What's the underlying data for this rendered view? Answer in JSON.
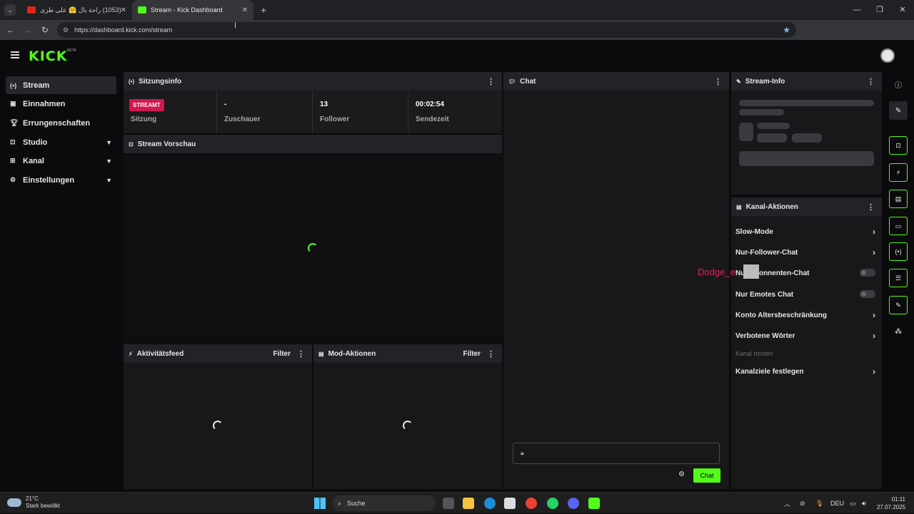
{
  "browser": {
    "tabs": [
      {
        "title": "(1053) راحة بال 🤗 علی طزی",
        "icon": "youtube-icon"
      },
      {
        "title": "Stream - Kick Dashboard",
        "icon": "kick-icon"
      }
    ],
    "url": "https://dashboard.kick.com/stream"
  },
  "app": {
    "logo": "KICK",
    "beta": "BETA"
  },
  "sidebar": {
    "items": [
      {
        "label": "Stream",
        "icon": "broadcast-icon",
        "active": true
      },
      {
        "label": "Einnahmen",
        "icon": "money-icon"
      },
      {
        "label": "Errungenschaften",
        "icon": "trophy-icon"
      },
      {
        "label": "Studio",
        "icon": "studio-icon",
        "expandable": true
      },
      {
        "label": "Kanal",
        "icon": "channel-icon",
        "expandable": true
      },
      {
        "label": "Einstellungen",
        "icon": "gear-icon",
        "expandable": true
      }
    ]
  },
  "session": {
    "title": "Sitzungsinfo",
    "badge": "STREAMT",
    "stats": [
      {
        "value": "",
        "label": "Sitzung"
      },
      {
        "value": "-",
        "label": "Zuschauer"
      },
      {
        "value": "13",
        "label": "Follower"
      },
      {
        "value": "00:02:54",
        "label": "Sendezeit"
      }
    ]
  },
  "preview": {
    "title": "Stream Vorschau"
  },
  "activity": {
    "title": "Aktivitätsfeed",
    "filter": "Filter"
  },
  "mod": {
    "title": "Mod-Aktionen",
    "filter": "Filter"
  },
  "chat": {
    "title": "Chat",
    "send": "Chat"
  },
  "streaminfo": {
    "title": "Stream-Info"
  },
  "channel_actions": {
    "title": "Kanal-Aktionen",
    "items": [
      {
        "label": "Slow-Mode",
        "type": "arrow"
      },
      {
        "label": "Nur-Follower-Chat",
        "type": "arrow"
      },
      {
        "label": "Nur Abonnenten-Chat",
        "type": "toggle"
      },
      {
        "label": "Nur Emotes Chat",
        "type": "toggle"
      },
      {
        "label": "Konto Altersbeschränkung",
        "type": "arrow"
      },
      {
        "label": "Verbotene Wörter",
        "type": "arrow"
      },
      {
        "label": "Kanal hosten",
        "type": "disabled"
      },
      {
        "label": "Kanalziele festlegen",
        "type": "arrow"
      }
    ]
  },
  "overlay": {
    "username": "Dodge_e"
  },
  "taskbar": {
    "weather_temp": "21°C",
    "weather_desc": "Stark bewölkt",
    "search": "Suche",
    "lang": "DEU",
    "time": "01:11",
    "date": "27.07.2025"
  },
  "colors": {
    "accent": "#53fc18",
    "live": "#d0174e"
  }
}
